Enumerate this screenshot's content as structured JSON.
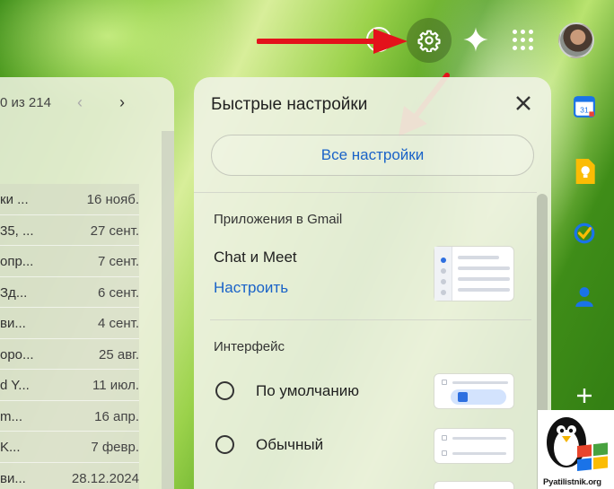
{
  "topbar": {
    "icons": [
      "help-icon",
      "settings-icon",
      "gemini-sparkle-icon",
      "apps-grid-icon",
      "account-avatar"
    ]
  },
  "mail_list": {
    "pager": "0 из 214",
    "rows": [
      {
        "subject": "ки ...",
        "date": "16 нояб."
      },
      {
        "subject": "35, ...",
        "date": "27 сент."
      },
      {
        "subject": "опр...",
        "date": "7 сент."
      },
      {
        "subject": "Зд...",
        "date": "6 сент."
      },
      {
        "subject": "ви...",
        "date": "4 сент."
      },
      {
        "subject": "оро...",
        "date": "25 авг."
      },
      {
        "subject": "d Y...",
        "date": "11 июл."
      },
      {
        "subject": "m...",
        "date": "16 апр."
      },
      {
        "subject": "K...",
        "date": "7 февр."
      },
      {
        "subject": "ви...",
        "date": "28.12.2024"
      }
    ]
  },
  "quick_settings": {
    "title": "Быстрые настройки",
    "all_settings_label": "Все настройки",
    "apps_section": {
      "title": "Приложения в Gmail",
      "chat_label": "Chat и Meet",
      "configure_link": "Настроить"
    },
    "interface_section": {
      "title": "Интерфейс",
      "options": [
        "По умолчанию",
        "Обычный"
      ]
    }
  },
  "watermark": {
    "text": "Pyatilistnik.org"
  },
  "colors": {
    "accent_blue": "#1a63c8",
    "arrow_red": "#e3121b"
  }
}
